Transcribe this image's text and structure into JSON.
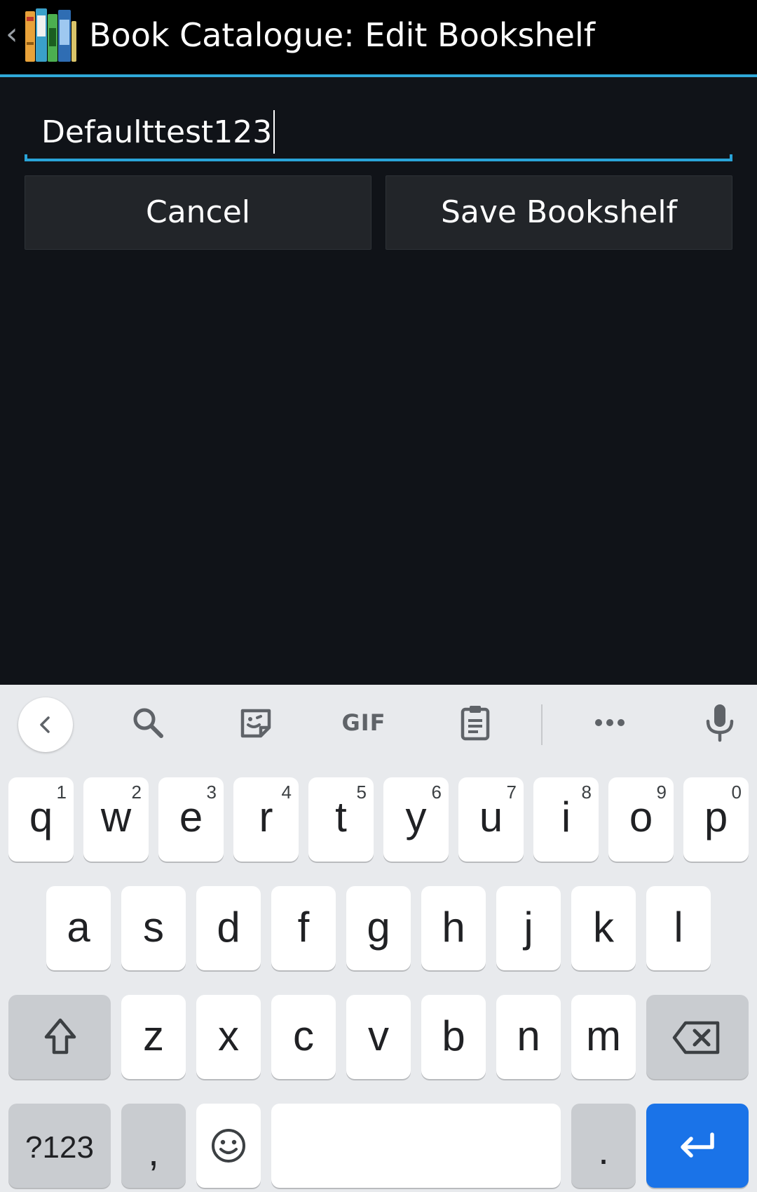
{
  "action_bar": {
    "title": "Book Catalogue: Edit Bookshelf",
    "back_icon": "chevron-left-icon",
    "app_icon": "books-icon",
    "accent_color": "#2fa8d8"
  },
  "form": {
    "name_value": "Defaulttest123",
    "cancel_label": "Cancel",
    "save_label": "Save Bookshelf"
  },
  "keyboard": {
    "toolbar": {
      "gif_label": "GIF"
    },
    "row1": [
      {
        "ch": "q",
        "num": "1"
      },
      {
        "ch": "w",
        "num": "2"
      },
      {
        "ch": "e",
        "num": "3"
      },
      {
        "ch": "r",
        "num": "4"
      },
      {
        "ch": "t",
        "num": "5"
      },
      {
        "ch": "y",
        "num": "6"
      },
      {
        "ch": "u",
        "num": "7"
      },
      {
        "ch": "i",
        "num": "8"
      },
      {
        "ch": "o",
        "num": "9"
      },
      {
        "ch": "p",
        "num": "0"
      }
    ],
    "row2": [
      "a",
      "s",
      "d",
      "f",
      "g",
      "h",
      "j",
      "k",
      "l"
    ],
    "row3": [
      "z",
      "x",
      "c",
      "v",
      "b",
      "n",
      "m"
    ],
    "symbols_label": "?123",
    "comma_label": ",",
    "period_label": ".",
    "enter_color": "#1a73e8"
  }
}
